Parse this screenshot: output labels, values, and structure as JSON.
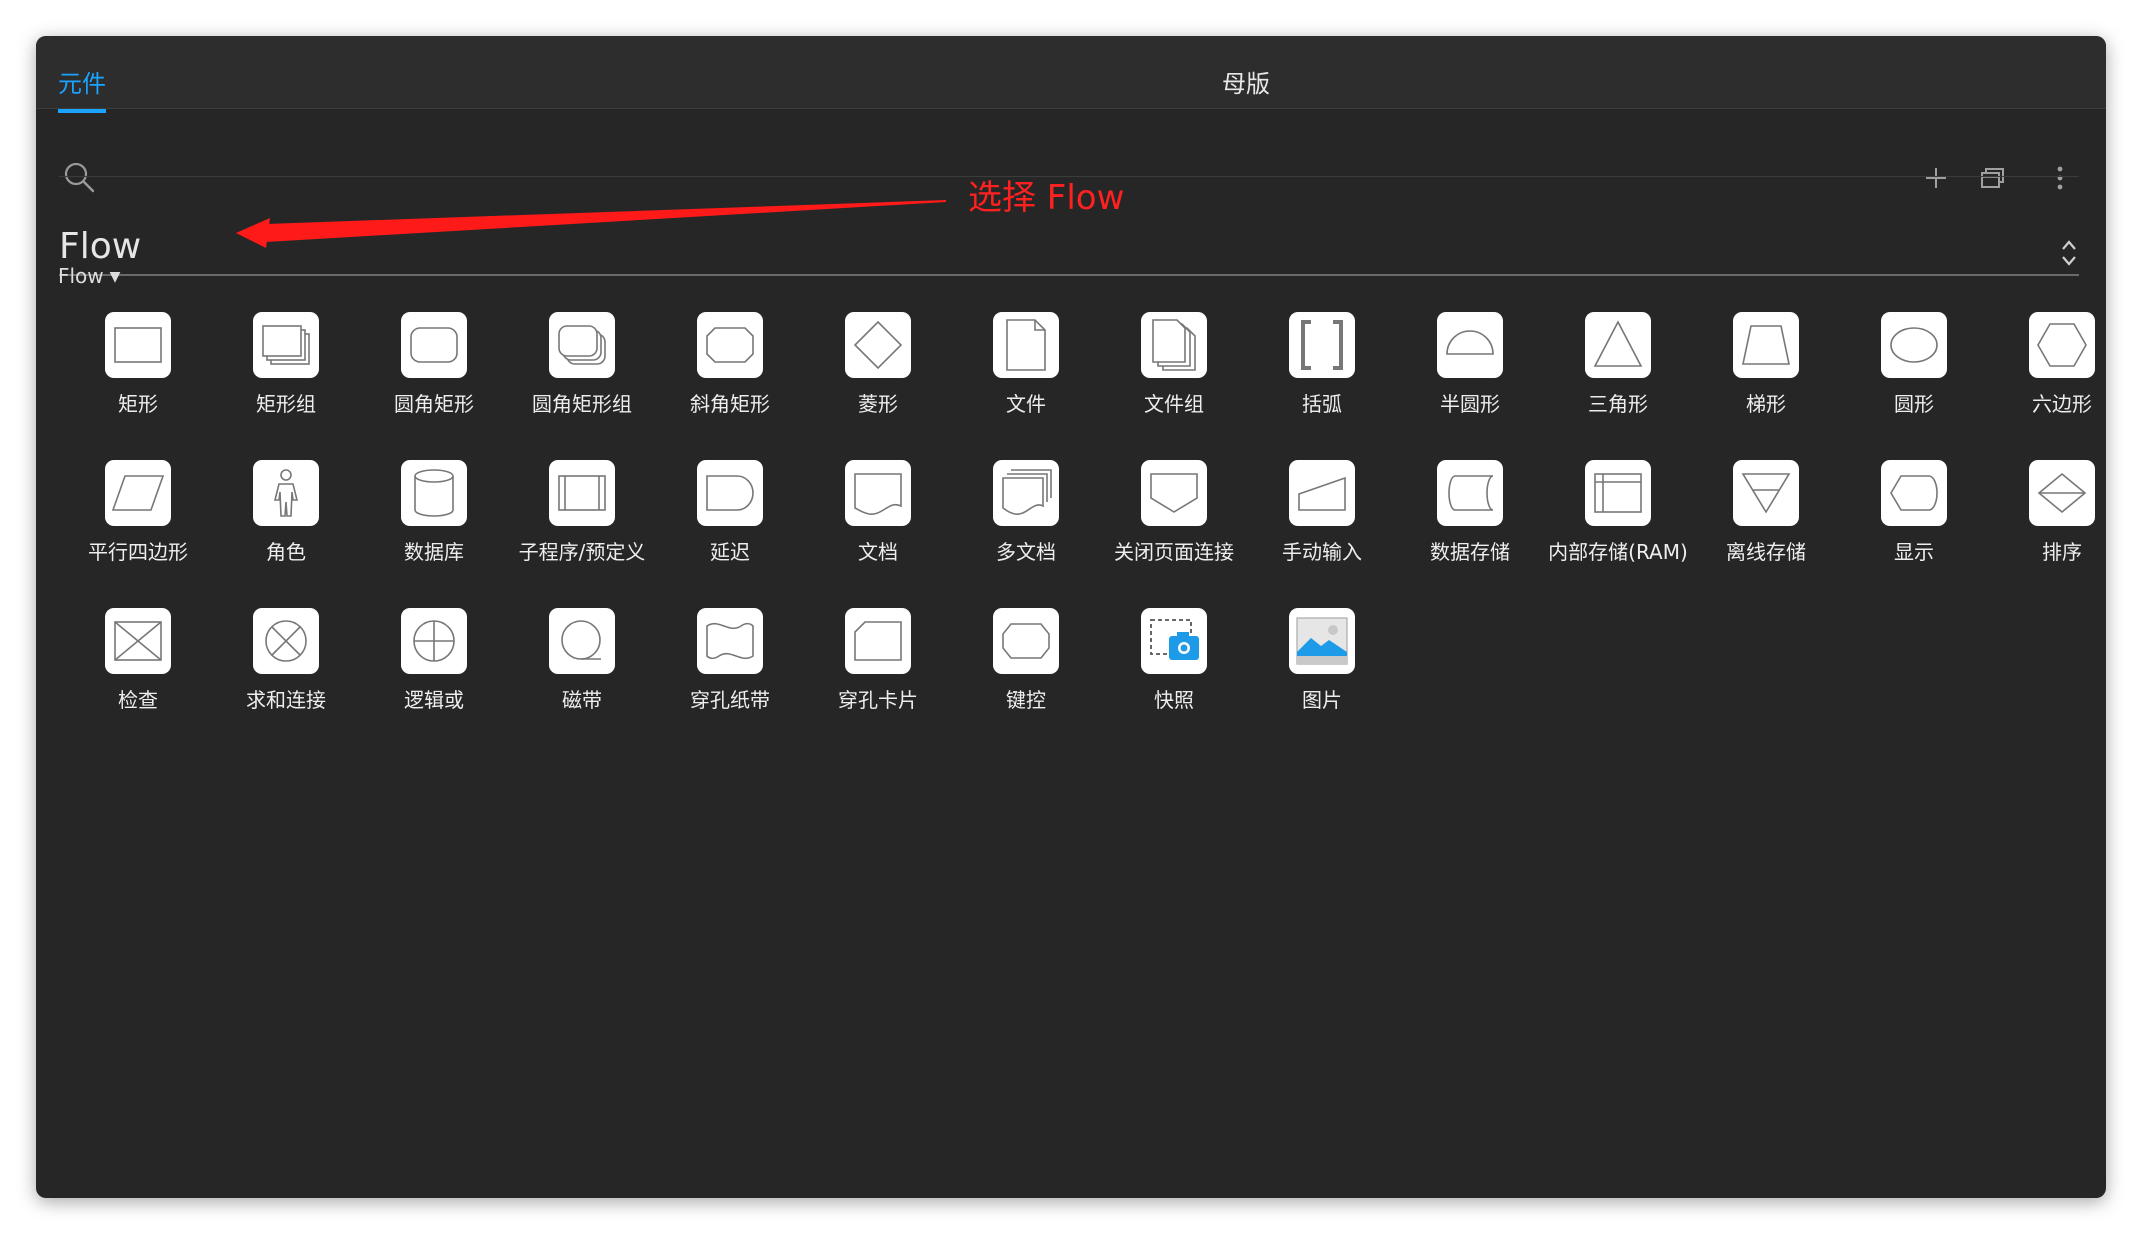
{
  "tabs": {
    "left": "元件",
    "center": "母版"
  },
  "toolbar": {
    "search_icon": "search-icon",
    "add_icon": "plus-icon",
    "duplicate_icon": "stack-icon",
    "more_icon": "more-vertical-icon"
  },
  "library": {
    "name": "Flow",
    "folder": "Flow"
  },
  "annotation": {
    "text": "选择 Flow",
    "color": "#ff2020"
  },
  "widgets": [
    {
      "label": "矩形",
      "icon": "rect"
    },
    {
      "label": "矩形组",
      "icon": "rectgroup"
    },
    {
      "label": "圆角矩形",
      "icon": "rounded"
    },
    {
      "label": "圆角矩形组",
      "icon": "roundedgroup"
    },
    {
      "label": "斜角矩形",
      "icon": "bevel"
    },
    {
      "label": "菱形",
      "icon": "diamond"
    },
    {
      "label": "文件",
      "icon": "file"
    },
    {
      "label": "文件组",
      "icon": "filegroup"
    },
    {
      "label": "括弧",
      "icon": "bracket"
    },
    {
      "label": "半圆形",
      "icon": "semicircle"
    },
    {
      "label": "三角形",
      "icon": "triangle"
    },
    {
      "label": "梯形",
      "icon": "trapezoid"
    },
    {
      "label": "圆形",
      "icon": "ellipse"
    },
    {
      "label": "六边形",
      "icon": "hexagon"
    },
    {
      "label": "平行四边形",
      "icon": "parallelogram"
    },
    {
      "label": "角色",
      "icon": "actor"
    },
    {
      "label": "数据库",
      "icon": "database"
    },
    {
      "label": "子程序/预定义",
      "icon": "subroutine"
    },
    {
      "label": "延迟",
      "icon": "delay"
    },
    {
      "label": "文档",
      "icon": "document"
    },
    {
      "label": "多文档",
      "icon": "multidoc"
    },
    {
      "label": "关闭页面连接",
      "icon": "offpage"
    },
    {
      "label": "手动输入",
      "icon": "manualinput"
    },
    {
      "label": "数据存储",
      "icon": "datastore"
    },
    {
      "label": "内部存储(RAM)",
      "icon": "internal"
    },
    {
      "label": "离线存储",
      "icon": "offline"
    },
    {
      "label": "显示",
      "icon": "display"
    },
    {
      "label": "排序",
      "icon": "sort"
    },
    {
      "label": "检查",
      "icon": "collate"
    },
    {
      "label": "求和连接",
      "icon": "summing"
    },
    {
      "label": "逻辑或",
      "icon": "or"
    },
    {
      "label": "磁带",
      "icon": "tape"
    },
    {
      "label": "穿孔纸带",
      "icon": "papertape"
    },
    {
      "label": "穿孔卡片",
      "icon": "card"
    },
    {
      "label": "键控",
      "icon": "terminal"
    },
    {
      "label": "快照",
      "icon": "snapshot"
    },
    {
      "label": "图片",
      "icon": "image"
    }
  ]
}
